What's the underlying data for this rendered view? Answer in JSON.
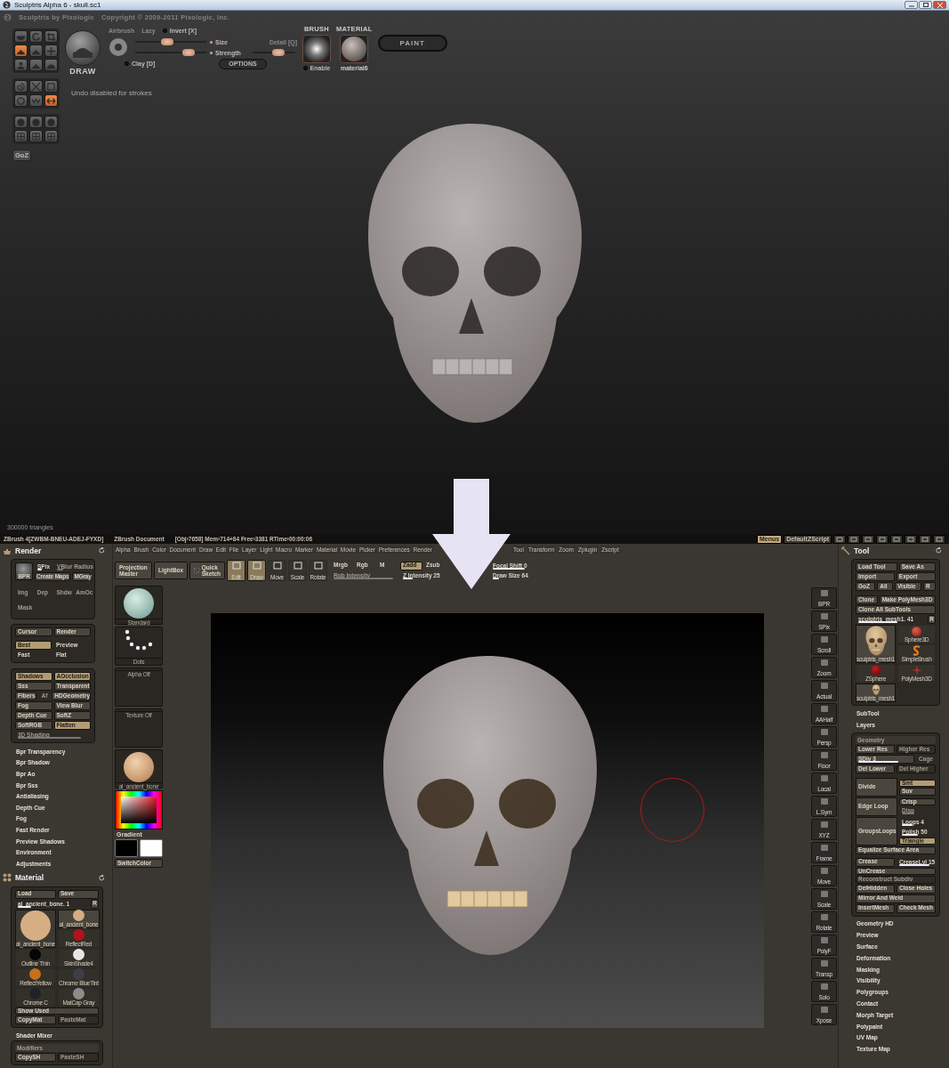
{
  "sculptris": {
    "title": "Sculptris Alpha 6 - skull.sc1",
    "brand": "Sculptris by Pixologic",
    "copyright": "Copyright © 2009-2011 Pixologic, Inc.",
    "tool_groups": [
      {
        "tools": [
          {
            "kind": "bowl",
            "selected": false
          },
          {
            "kind": "rotate",
            "selected": false
          },
          {
            "kind": "crop",
            "selected": false
          },
          {
            "kind": "mound",
            "selected": true
          },
          {
            "kind": "mound",
            "selected": false
          },
          {
            "kind": "move",
            "selected": false
          },
          {
            "kind": "figure",
            "selected": false
          },
          {
            "kind": "mound",
            "selected": false
          },
          {
            "kind": "dome",
            "selected": false
          }
        ]
      },
      {
        "tools": [
          {
            "kind": "swirl",
            "selected": false
          },
          {
            "kind": "cross",
            "selected": false
          },
          {
            "kind": "square",
            "selected": false
          },
          {
            "kind": "ring",
            "selected": false
          },
          {
            "kind": "zigzag",
            "selected": false
          },
          {
            "kind": "arrows",
            "selected": true
          }
        ]
      },
      {
        "tools": [
          {
            "kind": "sphere",
            "selected": false
          },
          {
            "kind": "sphere",
            "selected": false
          },
          {
            "kind": "sphere",
            "selected": false
          },
          {
            "kind": "grid",
            "selected": false
          },
          {
            "kind": "grid",
            "selected": false
          },
          {
            "kind": "grid",
            "selected": false
          }
        ]
      }
    ],
    "goz": "GoZ",
    "brush_name": "DRAW",
    "airbrush": "Airbrush",
    "lazy": "Lazy",
    "invert": {
      "label": "Invert [X]",
      "checked": false
    },
    "sliders": [
      {
        "label": "Size",
        "level": 0.45
      },
      {
        "label": "Strength",
        "level": 0.75
      }
    ],
    "detail": {
      "label": "Detail [Q]",
      "level": 0.6
    },
    "options": "OPTIONS",
    "clay": {
      "label": "Clay [D]",
      "checked": false
    },
    "brush": {
      "title": "BRUSH",
      "enable": {
        "label": "Enable",
        "checked": false
      }
    },
    "material": {
      "title": "MATERIAL",
      "name": "material6"
    },
    "paint": "PAINT",
    "message": "Undo disabled for strokes",
    "triangles": "300000 triangles"
  },
  "zbrush": {
    "title": "ZBrush 4[ZWBM-BNEU-ADEJ-FYXD]",
    "document": "ZBrush Document",
    "stats": "[Obj›7658] Mem›714+84 Free›3381 RTime›00:00:06",
    "menus_button": {
      "label": "Menus",
      "selected": true
    },
    "script": "DefaultZScript",
    "menu_left": [
      "Alpha",
      "Brush",
      "Color",
      "Document",
      "Draw",
      "Edit",
      "File",
      "Layer",
      "Light",
      "Macro",
      "Marker",
      "Material",
      "Movie",
      "Picker",
      "Preferences",
      "Render"
    ],
    "menu_right": [
      "Tool",
      "Transform",
      "Zoom",
      "Zplugin",
      "Zscript"
    ],
    "render": {
      "title": "Render",
      "bpr": "BPR",
      "spix": {
        "label": "SPix",
        "level": 0.35
      },
      "vblur": {
        "label": "VBlur Radius",
        "disabled": true,
        "level": 0.2
      },
      "create_maps": "Create Maps",
      "mgray": "MGray",
      "passes": [
        {
          "label": "Img",
          "disabled": true
        },
        {
          "label": "Dep",
          "disabled": true
        },
        {
          "label": "Shdw",
          "disabled": true
        },
        {
          "label": "AmOc",
          "disabled": true
        },
        {
          "label": "Mask",
          "disabled": true
        }
      ],
      "render_buttons": [
        "Cursor",
        "Render"
      ],
      "quality": [
        {
          "label": "Best",
          "selected": true
        },
        {
          "label": "Preview",
          "selected": false
        },
        {
          "label": "Fast",
          "selected": false
        },
        {
          "label": "Flat",
          "selected": false
        }
      ],
      "option_rows": [
        {
          "items": [
            {
              "label": "Shadows",
              "on": true
            },
            {
              "label": "AOcclusion",
              "on": true
            }
          ]
        },
        {
          "items": [
            {
              "label": "Sss",
              "on": false
            },
            {
              "label": "Transparent",
              "on": false
            }
          ]
        },
        {
          "items": [
            {
              "label": "Fibers",
              "on": false
            },
            {
              "label": "Af",
              "on": false,
              "disabled": true
            },
            {
              "label": "HDGeometry",
              "on": false
            }
          ]
        },
        {
          "items": [
            {
              "label": "Fog",
              "on": false
            },
            {
              "label": "View Blur",
              "on": false
            }
          ]
        },
        {
          "items": [
            {
              "label": "Depth Cue",
              "on": false
            },
            {
              "label": "SoftZ",
              "on": false
            }
          ]
        },
        {
          "items": [
            {
              "label": "SoftRGB",
              "on": false
            },
            {
              "label": "Flatten",
              "on": true
            }
          ]
        }
      ],
      "shading": {
        "label": "3D Shading",
        "disabled": true,
        "level": 0.9
      },
      "sections": [
        "Bpr Transparency",
        "Bpr Shadow",
        "Bpr Ao",
        "Bpr Sss",
        "Antialiasing",
        "Depth Cue",
        "Fog",
        "Fast Render",
        "Preview Shadows",
        "Environment",
        "Adjustments"
      ]
    },
    "material": {
      "title": "Material",
      "load": "Load",
      "save": "Save",
      "current": {
        "label": "al_ancient_bone. 1",
        "level": 0.2
      },
      "reset": "R",
      "main": {
        "label": "al_ancient_bone",
        "color": "#d6ae84"
      },
      "items": [
        {
          "label": "al_ancient_bone",
          "color": "#d6ae84",
          "selected": true
        },
        {
          "label": "ReflectRed",
          "color": "#b3121a",
          "selected": false
        },
        {
          "label": "Outline Thin",
          "color": "#050505",
          "selected": false
        },
        {
          "label": "SkinShade4",
          "color": "#e6e6e6",
          "selected": false
        },
        {
          "label": "ReflectYellow",
          "color": "#c4701c",
          "selected": false
        },
        {
          "label": "Chrome BlueTint",
          "color": "#3c3f48",
          "selected": false
        },
        {
          "label": "Chrome C",
          "color": "#202226",
          "selected": false
        },
        {
          "label": "MatCap Gray",
          "color": "#8c8c8c",
          "selected": false
        }
      ],
      "show_used": "Show Used",
      "copy": "CopyMat",
      "paste": {
        "label": "PasteMat",
        "disabled": true
      },
      "shader_mixer": "Shader Mixer",
      "modifiers": {
        "title": "Modifiers",
        "copy": "CopySH",
        "paste": {
          "label": "PasteSH",
          "disabled": true
        }
      }
    },
    "tray": [
      {
        "label": "Standard",
        "kind": "brush"
      },
      {
        "label": "Dots",
        "kind": "stroke"
      },
      {
        "label": "Alpha Off",
        "kind": "empty"
      },
      {
        "label": "Texture Off",
        "kind": "empty"
      },
      {
        "label": "al_ancient_bone",
        "kind": "material"
      }
    ],
    "gradient": "Gradient",
    "swatches": [
      {
        "color": "#000000"
      },
      {
        "color": "#ffffff"
      }
    ],
    "switch_color": "SwitchColor",
    "shelf": [
      {
        "label": "Projection Master",
        "kind": "wide"
      },
      {
        "label": "LightBox",
        "kind": "wide"
      },
      {
        "label": "Quick Sketch",
        "kind": "sketch"
      },
      {
        "label": "Edit",
        "kind": "mode",
        "on": true
      },
      {
        "label": "Draw",
        "kind": "mode",
        "on": true
      },
      {
        "label": "Move",
        "kind": "mode",
        "on": false
      },
      {
        "label": "Scale",
        "kind": "mode",
        "on": false
      },
      {
        "label": "Rotate",
        "kind": "mode",
        "on": false
      }
    ],
    "channels": [
      {
        "label": "Mrgb",
        "on": false
      },
      {
        "label": "Rgb",
        "on": false
      },
      {
        "label": "M",
        "on": false
      },
      {
        "label": "Zadd",
        "on": true
      },
      {
        "label": "Zsub",
        "on": false
      }
    ],
    "rgb_intensity": {
      "label": "Rgb Intensity",
      "disabled": true,
      "level": 0.95
    },
    "z_intensity": {
      "label": "Z Intensity 25",
      "level": 0.25
    },
    "focal_shift": {
      "label": "Focal Shift 0",
      "level": 0.5
    },
    "draw_size": {
      "label": "Draw Size 64",
      "level": 0.1
    },
    "right_shelf": [
      "BPR",
      "SPix",
      "Scroll",
      "Zoom",
      "Actual",
      "AAHalf",
      "Persp",
      "Floor",
      "Local",
      "L.Sym",
      "XYZ",
      "Frame",
      "Move",
      "Scale",
      "Rotate",
      "PolyF",
      "Transp",
      "Solo",
      "Xpose"
    ],
    "tool": {
      "title": "Tool",
      "rows": [
        {
          "items": [
            "Load Tool",
            "Save As"
          ]
        },
        {
          "items": [
            "Import",
            "Export"
          ]
        },
        {
          "items": [
            "GoZ",
            "All",
            "Visible",
            "R"
          ]
        },
        {
          "items": [
            "Clone",
            "Make PolyMesh3D"
          ]
        },
        {
          "items": [
            "Clone All SubTools"
          ]
        }
      ],
      "current": {
        "label": "sculptris_mesh1. 41",
        "level": 0.6
      },
      "reset": "R",
      "main": {
        "label": "sculptris_mesh1"
      },
      "items": [
        {
          "label": "Sphere3D",
          "kind": "sphere"
        },
        {
          "label": "SimpleBrush",
          "kind": "brush"
        },
        {
          "label": "ZSphere",
          "kind": "zsphere"
        },
        {
          "label": "PolyMesh3D",
          "kind": "star"
        },
        {
          "label": "sculptris_mesh1",
          "kind": "skull"
        }
      ],
      "sections_top": [
        "SubTool",
        "Layers"
      ],
      "geometry": {
        "title": "Geometry",
        "lower_res": "Lower Res",
        "higher_res": {
          "label": "Higher Res",
          "disabled": true
        },
        "sdiv": {
          "label": "SDiv 3",
          "level": 0.75
        },
        "cage": {
          "label": "Cage",
          "disabled": true
        },
        "del_lower": "Del Lower",
        "del_higher": {
          "label": "Del Higher",
          "disabled": true
        },
        "divide": "Divide",
        "smt": {
          "label": "Smt",
          "on": true
        },
        "suv": {
          "label": "Suv",
          "on": false
        },
        "edge_loop": "Edge Loop",
        "crisp": {
          "label": "Crisp",
          "on": false
        },
        "disp": {
          "label": "Disp",
          "disabled": true,
          "level": 0.4
        },
        "groups_loops": "GroupsLoops",
        "loops": {
          "label": "Loops 4",
          "level": 0.35
        },
        "polish": {
          "label": "Polish 50",
          "level": 0.5
        },
        "triangle": {
          "label": "Triangle",
          "on": true
        },
        "equalize": "Equalize Surface Area",
        "crease": "Crease",
        "crease_lvl": {
          "label": "CreaseLvl 15",
          "level": 0.9
        },
        "uncrease": "UnCrease",
        "reconstruct": {
          "label": "Reconstruct Subdiv",
          "disabled": true
        },
        "pairs": [
          {
            "items": [
              "DelHidden",
              "Close Holes"
            ]
          },
          {
            "items": [
              "Mirror And Weld"
            ]
          },
          {
            "items": [
              "InsertMesh",
              "Check Mesh"
            ]
          }
        ]
      },
      "sections": [
        "Geometry HD",
        "Preview",
        "Surface",
        "Deformation",
        "Masking",
        "Visibility",
        "Polygroups",
        "Contact",
        "Morph Target",
        "Polypaint",
        "UV Map",
        "Texture Map"
      ]
    }
  }
}
